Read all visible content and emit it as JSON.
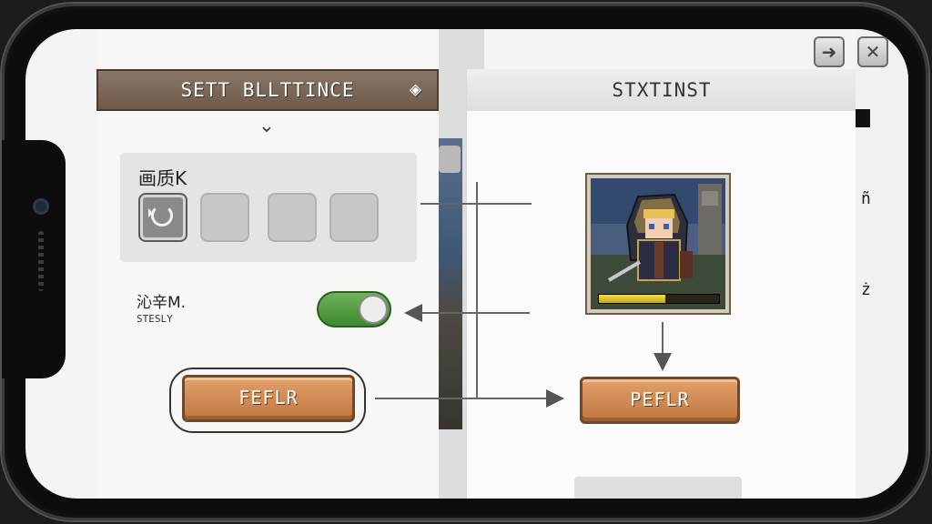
{
  "settings_panel": {
    "title": "SETT BLLTTINCE",
    "header_icon": "diamond-icon",
    "collapse_icon": "chevron-down-icon",
    "quality": {
      "label": "画质K",
      "options": [
        {
          "icon": "refresh-icon",
          "selected": true
        },
        {
          "icon": "",
          "selected": false
        },
        {
          "icon": "",
          "selected": false
        },
        {
          "icon": "",
          "selected": false
        }
      ]
    },
    "sound": {
      "label": "沁辛M.",
      "sublabel": "STESLY",
      "enabled": true
    },
    "refresh_button": "FEFLR"
  },
  "status_panel": {
    "title": "STXTINST",
    "character_hp_fraction": 0.55,
    "refresh_button": "PEFLR"
  },
  "right_edge": {
    "glyphs": [
      "ñ",
      "ż"
    ]
  },
  "top_buttons": {
    "forward_icon": "arrow-right-icon",
    "close_icon": "close-icon"
  },
  "colors": {
    "wood_button": "#c8804a",
    "toggle_on": "#4f9a3c",
    "header_brown": "#7b6756",
    "hp_fill": "#e6cf36"
  }
}
